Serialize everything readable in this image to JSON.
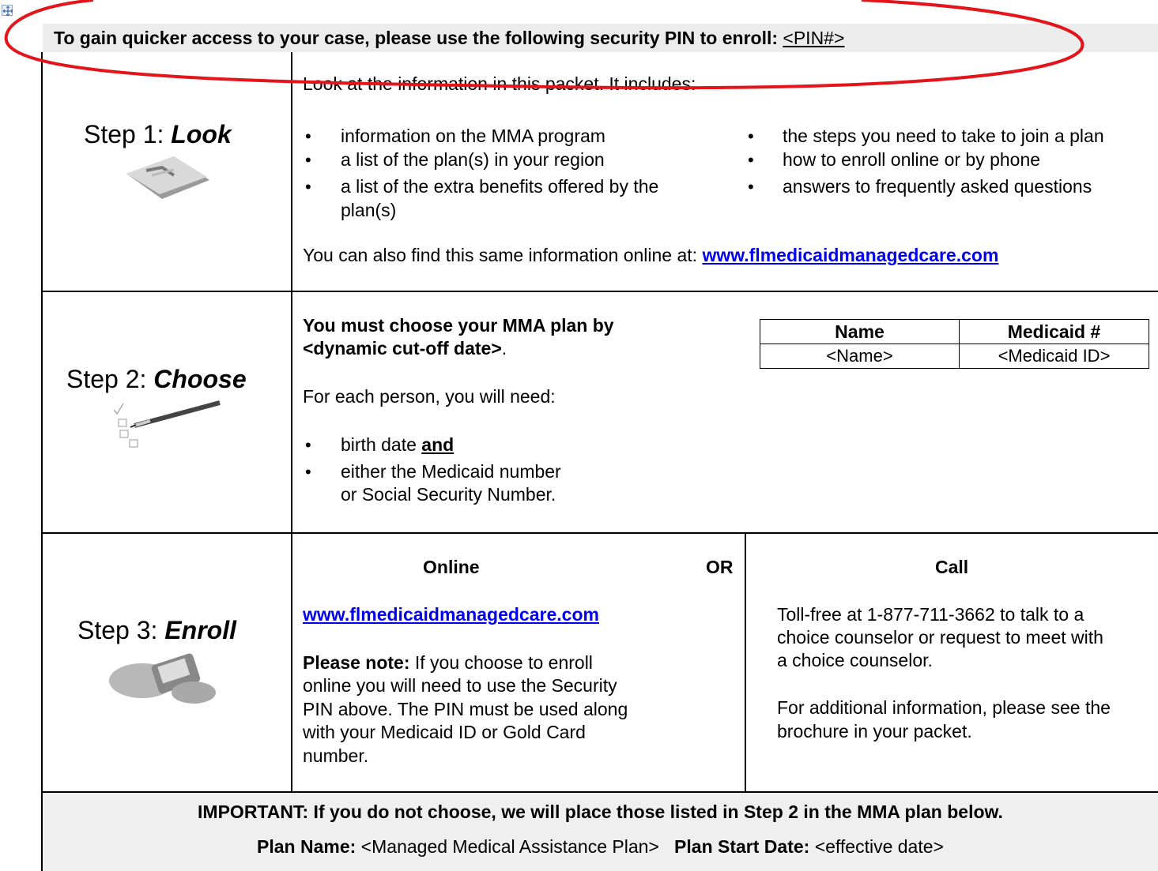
{
  "pin_banner": {
    "text": "To gain quicker access to your case, please use the following security PIN to enroll: ",
    "pin": "<PIN#>"
  },
  "step1": {
    "label_prefix": "Step 1: ",
    "label_word": "Look",
    "intro": "Look at the information in this packet. It includes:",
    "bullets_left": [
      "information on the MMA program",
      "a list of the plan(s) in your  region",
      "a list of the extra benefits offered by the",
      "plan(s)"
    ],
    "bullets_right": [
      "the steps you need to take to join a plan",
      "how to enroll online or by phone",
      "answers to frequently asked questions"
    ],
    "online_text": "You can also find this same information online at: ",
    "online_link": "www.flmedicaidmanagedcare.com"
  },
  "step2": {
    "label_prefix": "Step 2: ",
    "label_word": "Choose",
    "deadline_line1": "You must choose your MMA plan by",
    "deadline_line2": "<dynamic cut-off date>",
    "deadline_end": ".",
    "need_text": "For each person, you will need:",
    "bullet1": "birth date ",
    "bullet1_and": "and",
    "bullet2_word": "either",
    "bullet2_rest": " the Medicaid number",
    "bullet2_line2": "or Social Security Number.",
    "table": {
      "headers": [
        "Name",
        "Medicaid #"
      ],
      "row": [
        "<Name>",
        "<Medicaid ID>"
      ]
    }
  },
  "step3": {
    "label_prefix": "Step 3: ",
    "label_word": "Enroll",
    "online_header": "Online",
    "or_label": "OR",
    "call_header": "Call",
    "online_link": "www.flmedicaidmanagedcare.com",
    "note_bold": "Please note:",
    "note_lines": [
      " If you choose to enroll",
      "online you will need to use the Security",
      "PIN above. The PIN must be used along",
      "with your Medicaid ID or Gold Card",
      "number."
    ],
    "call_lines": [
      "Toll-free at 1-877-711-3662 to talk to a",
      "choice counselor or request to meet with",
      "a choice counselor."
    ],
    "info_lines": [
      "For additional information, please see the",
      "brochure in your packet."
    ]
  },
  "important": {
    "line": "IMPORTANT: If you do not choose, we will place those listed in Step 2 in the MMA plan below.",
    "plan_name_label": "Plan Name:",
    "plan_name_value": " <Managed Medical Assistance Plan>   ",
    "start_label": "Plan Start Date:",
    "start_value": " <effective date>"
  }
}
